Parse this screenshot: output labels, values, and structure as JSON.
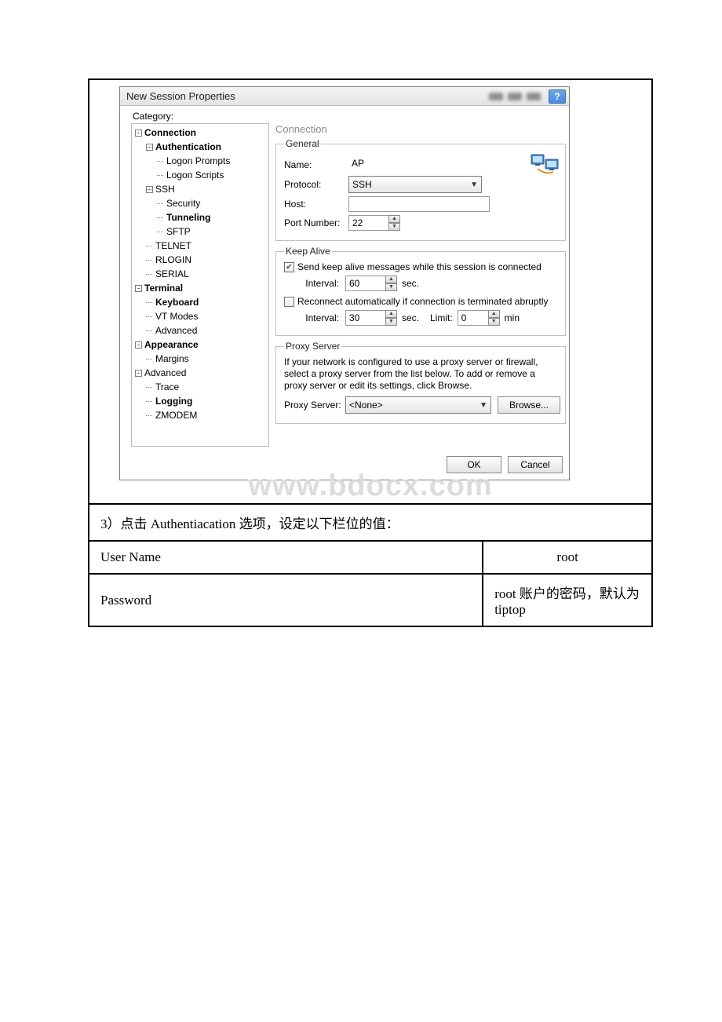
{
  "window": {
    "title": "New Session Properties",
    "help_icon": "?"
  },
  "category_label": "Category:",
  "tree": {
    "connection": "Connection",
    "authentication": "Authentication",
    "logon_prompts": "Logon Prompts",
    "logon_scripts": "Logon Scripts",
    "ssh": "SSH",
    "security": "Security",
    "tunneling": "Tunneling",
    "sftp": "SFTP",
    "telnet": "TELNET",
    "rlogin": "RLOGIN",
    "serial": "SERIAL",
    "terminal": "Terminal",
    "keyboard": "Keyboard",
    "vt_modes": "VT Modes",
    "t_advanced": "Advanced",
    "appearance": "Appearance",
    "margins": "Margins",
    "a_advanced": "Advanced",
    "trace": "Trace",
    "logging": "Logging",
    "zmodem": "ZMODEM"
  },
  "right": {
    "header": "Connection",
    "general": {
      "legend": "General",
      "name_label": "Name:",
      "name_value": "AP",
      "protocol_label": "Protocol:",
      "protocol_value": "SSH",
      "host_label": "Host:",
      "host_value": "",
      "port_label": "Port Number:",
      "port_value": "22"
    },
    "keepalive": {
      "legend": "Keep Alive",
      "send_label": "Send keep alive messages while this session is connected",
      "interval_label": "Interval:",
      "interval_value": "60",
      "sec": "sec.",
      "reconnect_label": "Reconnect automatically if connection is terminated abruptly",
      "interval2_label": "Interval:",
      "interval2_value": "30",
      "limit_label": "Limit:",
      "limit_value": "0",
      "min": "min"
    },
    "proxy": {
      "legend": "Proxy Server",
      "text": "If your network is configured to use a proxy server or firewall, select a proxy server from the list below. To add or remove a proxy server or edit its settings, click Browse.",
      "label": "Proxy Server:",
      "value": "<None>",
      "browse": "Browse..."
    },
    "ok": "OK",
    "cancel": "Cancel"
  },
  "watermark": "www.bdocx.com",
  "instruction": "3）点击 Authentiacation 选项，设定以下栏位的值：",
  "cred": {
    "user_label": "User Name",
    "user_value": "root",
    "pass_label": "Password",
    "pass_value": "root 账户的密码，默认为tiptop"
  }
}
